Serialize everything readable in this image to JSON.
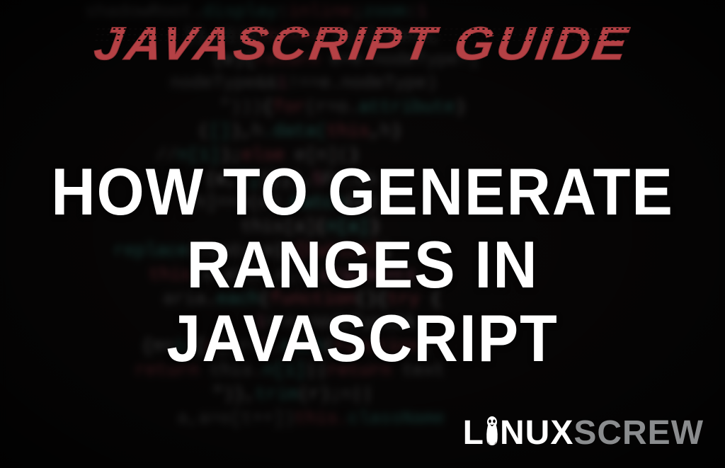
{
  "banner": {
    "top_title": "JAVASCRIPT GUIDE",
    "main_title_line1": "HOW TO GENERATE",
    "main_title_line2": "RANGES IN JAVASCRIPT"
  },
  "logo": {
    "word1_part1": "L",
    "word1_part2": "NUX",
    "word2": "SCREW"
  },
  "bg_code_lines": [
    {
      "segments": [
        {
          "t": "shadowRoot",
          "c": "k-grey"
        },
        {
          "t": ".",
          "c": "k-white"
        },
        {
          "t": "display",
          "c": "k-teal"
        },
        {
          "t": ":",
          "c": "k-white"
        },
        {
          "t": "inline",
          "c": "k-red"
        },
        {
          "t": ";",
          "c": "k-white"
        },
        {
          "t": "zoom",
          "c": "k-teal"
        },
        {
          "t": ":",
          "c": "k-white"
        },
        {
          "t": "1",
          "c": "k-pink"
        }
      ]
    },
    {
      "segments": [
        {
          "t": "}),",
          "c": "k-white"
        },
        {
          "t": "d",
          "c": "k-teal"
        },
        {
          "t": "||(",
          "c": "k-white"
        },
        {
          "t": "delete ",
          "c": "k-red"
        },
        {
          "t": "s[u].data",
          "c": "k-grey"
        },
        {
          "t": ",",
          "c": "k-white"
        }
      ]
    },
    {
      "segments": [
        {
          "t": "(e){",
          "c": "k-white"
        },
        {
          "t": "return ",
          "c": "k-red"
        },
        {
          "t": "e=e.nodeType?",
          "c": "k-grey"
        },
        {
          "t": ";",
          "c": "k-white"
        }
      ]
    },
    {
      "segments": [
        {
          "t": "nodeType&&",
          "c": "k-grey"
        },
        {
          "t": "1",
          "c": "k-pink"
        },
        {
          "t": "!==e.nodeType)",
          "c": "k-grey"
        }
      ]
    },
    {
      "segments": [
        {
          "t": "\")))",
          "c": "k-grey"
        },
        {
          "t": "{",
          "c": "k-white"
        },
        {
          "t": "for",
          "c": "k-red"
        },
        {
          "t": "(r=o.",
          "c": "k-grey"
        },
        {
          "t": "attribute",
          "c": "k-teal"
        },
        {
          "t": ")",
          "c": "k-white"
        }
      ]
    },
    {
      "segments": [
        {
          "t": "(",
          "c": "k-white"
        },
        {
          "t": "[]",
          "c": "k-teal"
        },
        {
          "t": "),",
          "c": "k-white"
        },
        {
          "t": "h",
          "c": "k-grey"
        },
        {
          "t": ".data(",
          "c": "k-teal"
        },
        {
          "t": "this",
          "c": "k-red"
        },
        {
          "t": ",",
          "c": "k-white"
        },
        {
          "t": "h",
          "c": "k-grey"
        },
        {
          "t": ")",
          "c": "k-white"
        }
      ]
    },
    {
      "segments": [
        {
          "t": "//",
          "c": "k-grey"
        },
        {
          "t": "n[1]",
          "c": "k-teal"
        },
        {
          "t": ");",
          "c": "k-white"
        },
        {
          "t": "else ",
          "c": "k-red"
        },
        {
          "t": "e[n](",
          "c": "k-grey"
        },
        {
          "t": ")",
          "c": "k-white"
        }
      ]
    },
    {
      "segments": [
        {
          "t": "(e,",
          "c": "k-white"
        },
        {
          "t": "[]",
          "c": "k-teal"
        },
        {
          "t": ")})),",
          "c": "k-white"
        },
        {
          "t": "5",
          "c": "k-pink"
        },
        {
          "t": "Fe.on",
          "c": "k-grey"
        }
      ]
    },
    {
      "segments": [
        {
          "t": "[",
          "c": "k-white"
        },
        {
          "t": "h",
          "c": "k-grey"
        },
        {
          "t": "]==n(e).",
          "c": "k-grey"
        },
        {
          "t": "match",
          "c": "k-teal"
        },
        {
          "t": "(r)",
          "c": "k-white"
        }
      ]
    },
    {
      "segments": [
        {
          "t": "this[a]",
          "c": "k-grey"
        },
        {
          "t": "(",
          "c": "k-white"
        },
        {
          "t": "n[a]",
          "c": "k-teal"
        },
        {
          "t": ")",
          "c": "k-white"
        }
      ]
    },
    {
      "segments": [
        {
          "t": "replace",
          "c": "k-teal"
        },
        {
          "t": "(",
          "c": "k-white"
        },
        {
          "t": "feature",
          "c": "k-grey"
        },
        {
          "t": "|",
          "c": "k-white"
        },
        {
          "t": "a[button]",
          "c": "k-red"
        },
        {
          "t": ")",
          "c": "k-white"
        }
      ]
    },
    {
      "segments": [
        {
          "t": "this",
          "c": "k-red"
        },
        {
          "t": ",b.attr,e,t,",
          "c": "k-grey"
        },
        {
          "t": "arguments",
          "c": "k-pink"
        }
      ]
    },
    {
      "segments": [
        {
          "t": "aria",
          "c": "k-grey"
        },
        {
          "t": ".",
          "c": "k-white"
        },
        {
          "t": "each",
          "c": "k-teal"
        },
        {
          "t": "(",
          "c": "k-white"
        },
        {
          "t": "function",
          "c": "k-red"
        },
        {
          "t": "(){",
          "c": "k-white"
        },
        {
          "t": "try ",
          "c": "k-red"
        },
        {
          "t": "{",
          "c": "k-white"
        }
      ]
    },
    {
      "segments": [
        {
          "t": "1",
          "c": "k-pink"
        },
        {
          "t": "==n.nodeType&&",
          "c": "k-grey"
        }
      ]
    },
    {
      "segments": [
        {
          "t": "{n=",
          "c": "k-white"
        },
        {
          "t": "is",
          "c": "k-teal"
        },
        {
          "t": "[",
          "c": "k-white"
        },
        {
          "t": "a",
          "c": "k-red"
        },
        {
          "t": "],r=",
          "c": "k-grey"
        },
        {
          "t": "1",
          "c": "k-pink"
        },
        {
          "t": ".",
          "c": "k-white"
        },
        {
          "t": "each",
          "c": "k-teal"
        },
        {
          "t": "(",
          "c": "k-white"
        },
        {
          "t": "function",
          "c": "k-red"
        },
        {
          "t": "(",
          "c": "k-white"
        }
      ]
    },
    {
      "segments": [
        {
          "t": "return ",
          "c": "k-red"
        },
        {
          "t": "this.",
          "c": "k-grey"
        },
        {
          "t": "n[1]",
          "c": "k-teal"
        },
        {
          "t": "||",
          "c": "k-white"
        },
        {
          "t": "return ",
          "c": "k-red"
        },
        {
          "t": "text",
          "c": "k-grey"
        }
      ]
    },
    {
      "segments": [
        {
          "t": "\")},",
          "c": "k-white"
        },
        {
          "t": "trim",
          "c": "k-teal"
        },
        {
          "t": "(r);",
          "c": "k-white"
        },
        {
          "t": "n",
          "c": "k-grey"
        },
        {
          "t": "||",
          "c": "k-white"
        }
      ]
    },
    {
      "segments": [
        {
          "t": "a,a=o[t++])",
          "c": "k-grey"
        },
        {
          "t": "this.",
          "c": "k-red"
        },
        {
          "t": "className",
          "c": "k-teal"
        }
      ]
    }
  ]
}
